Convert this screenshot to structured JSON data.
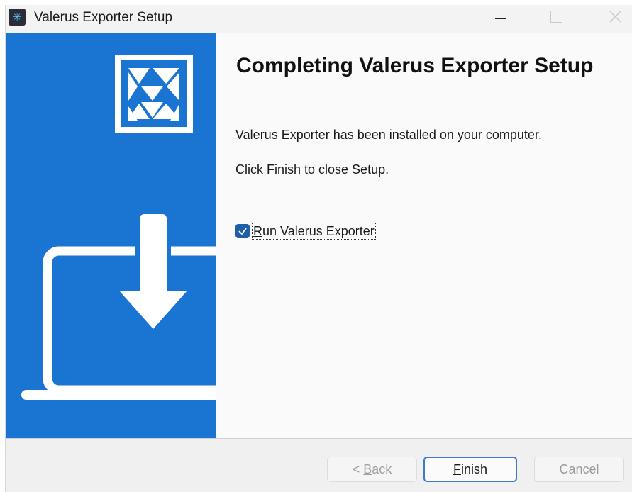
{
  "window": {
    "title": "Valerus Exporter Setup",
    "app_icon": "asterisk-icon"
  },
  "page": {
    "heading": "Completing Valerus Exporter Setup",
    "installed_text": "Valerus Exporter has been installed on your computer.",
    "finish_hint": "Click Finish to close Setup."
  },
  "run_option": {
    "checked": true,
    "label_first": "R",
    "label_rest": "un Valerus Exporter"
  },
  "buttons": {
    "back_prefix": "< ",
    "back_key": "B",
    "back_rest": "ack",
    "finish_key": "F",
    "finish_rest": "inish",
    "cancel": "Cancel"
  },
  "colors": {
    "banner": "#1a74d2",
    "accent": "#3c7bd0"
  }
}
